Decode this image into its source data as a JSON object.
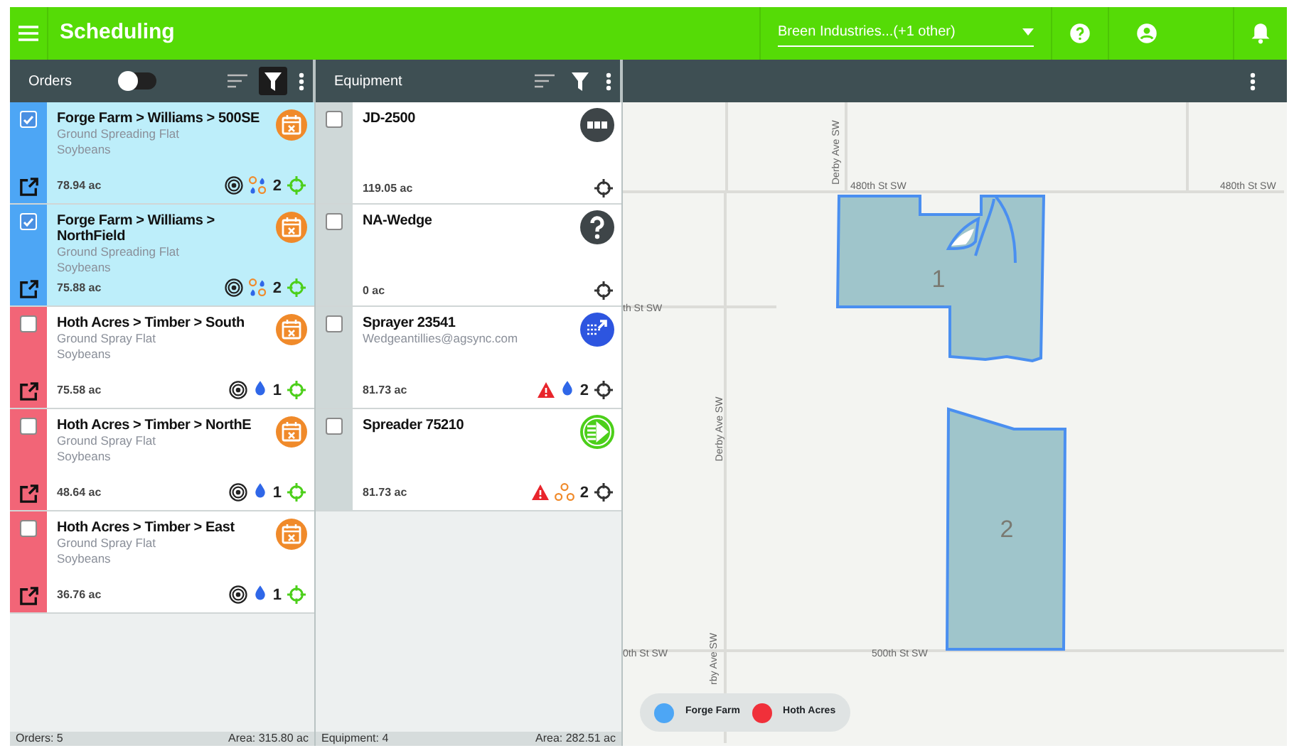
{
  "header": {
    "title": "Scheduling",
    "org_select": {
      "value": "Breen Industries...(+1 other)"
    }
  },
  "orders_panel": {
    "title": "Orders",
    "toggle_on": false,
    "filter_active": true,
    "items": [
      {
        "title": "Forge Farm > Williams > 500SE",
        "operation": "Ground Spreading Flat",
        "crop": "Soybeans",
        "area": "78.94 ac",
        "color": "#4da6f5",
        "checked": true,
        "selected": true,
        "product": {
          "kind": "mixed",
          "count": "2"
        }
      },
      {
        "title": "Forge Farm > Williams > NorthField",
        "operation": "Ground Spreading Flat",
        "crop": "Soybeans",
        "area": "75.88 ac",
        "color": "#4da6f5",
        "checked": true,
        "selected": true,
        "product": {
          "kind": "mixed",
          "count": "2"
        }
      },
      {
        "title": "Hoth Acres > Timber > South",
        "operation": "Ground Spray Flat",
        "crop": "Soybeans",
        "area": "75.58 ac",
        "color": "#f26577",
        "checked": false,
        "selected": false,
        "product": {
          "kind": "liquid",
          "count": "1"
        }
      },
      {
        "title": "Hoth Acres > Timber > NorthE",
        "operation": "Ground Spray Flat",
        "crop": "Soybeans",
        "area": "48.64 ac",
        "color": "#f26577",
        "checked": false,
        "selected": false,
        "product": {
          "kind": "liquid",
          "count": "1"
        }
      },
      {
        "title": "Hoth Acres > Timber > East",
        "operation": "Ground Spray Flat",
        "crop": "Soybeans",
        "area": "36.76 ac",
        "color": "#f26577",
        "checked": false,
        "selected": false,
        "product": {
          "kind": "liquid",
          "count": "1"
        }
      }
    ],
    "footer": {
      "count": "Orders: 5",
      "area": "Area: 315.80 ac"
    }
  },
  "equipment_panel": {
    "title": "Equipment",
    "filter_active": false,
    "items": [
      {
        "name": "JD-2500",
        "area": "119.05 ac",
        "kind": "busy",
        "checked": false,
        "warning": false
      },
      {
        "name": "NA-Wedge",
        "area": "0 ac",
        "kind": "unknown",
        "checked": false,
        "warning": false
      },
      {
        "name": "Sprayer 23541",
        "detail": "Wedgeantillies@agsync.com",
        "area": "81.73 ac",
        "kind": "sprayer",
        "checked": false,
        "warning": true,
        "product": {
          "kind": "liquid",
          "count": "2"
        }
      },
      {
        "name": "Spreader 75210",
        "area": "81.73 ac",
        "kind": "spreader",
        "checked": false,
        "warning": true,
        "product": {
          "kind": "dry",
          "count": "2"
        }
      }
    ],
    "footer": {
      "count": "Equipment: 4",
      "area": "Area: 282.51 ac"
    }
  },
  "map": {
    "street_labels": [
      "Derby Ave SW",
      "480th St SW",
      "480th St SW",
      "th St SW",
      "Derby Ave SW",
      "0th St SW",
      "500th St SW",
      "rby Ave SW"
    ],
    "fields": [
      {
        "label": "1"
      },
      {
        "label": "2"
      }
    ],
    "legend": [
      {
        "label": "Forge Farm",
        "color": "#4da6f5"
      },
      {
        "label": "Hoth Acres",
        "color": "#f0303a"
      }
    ]
  }
}
